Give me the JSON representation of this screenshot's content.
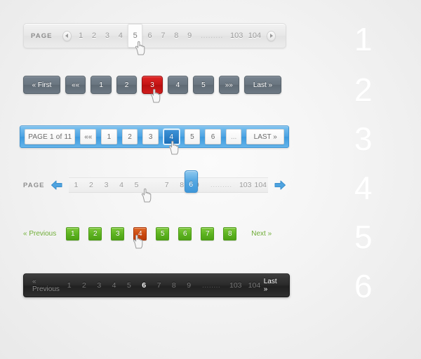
{
  "markers": [
    "1",
    "2",
    "3",
    "4",
    "5",
    "6"
  ],
  "style1": {
    "name": "light-pagination-bar",
    "label": "PAGE",
    "prev_icon": "left-arrow-circle-icon",
    "next_icon": "right-arrow-circle-icon",
    "pages": [
      "1",
      "2",
      "3",
      "4"
    ],
    "active": "5",
    "pages_after": [
      "6",
      "7",
      "8",
      "9"
    ],
    "ellipsis": ".........",
    "tail_pages": [
      "103",
      "104"
    ]
  },
  "style2": {
    "name": "slate-button-pagination",
    "first_label": "« First",
    "prev_label": "««",
    "pages": [
      "1",
      "2"
    ],
    "active": "3",
    "pages_after": [
      "4",
      "5"
    ],
    "next_label": "»»",
    "last_label": "Last »",
    "active_color": "#c31414",
    "button_color": "#69757f"
  },
  "style3": {
    "name": "blue-bar-pagination",
    "page_info": "PAGE 1 of 11",
    "prev_label": "««",
    "pages": [
      "1",
      "2",
      "3"
    ],
    "active": "4",
    "pages_after": [
      "5",
      "6"
    ],
    "ellipsis": "...",
    "last_label": "LAST »",
    "bar_color": "#4ba3e3",
    "active_color": "#1c6fb8"
  },
  "style4": {
    "name": "slider-pagination",
    "label": "PAGE",
    "prev_icon": "left-arrow-icon",
    "next_icon": "right-arrow-icon",
    "pages": [
      "1",
      "2",
      "3",
      "4",
      "5"
    ],
    "active": "6",
    "pages_after": [
      "7",
      "8",
      "9"
    ],
    "ellipsis": ".........",
    "tail_pages": [
      "103",
      "104"
    ],
    "handle_color": "#57a8e2"
  },
  "style5": {
    "name": "green-square-pagination",
    "prev_label": "« Previous",
    "pages": [
      "1",
      "2",
      "3"
    ],
    "active": "4",
    "pages_after": [
      "5",
      "6",
      "7",
      "8"
    ],
    "next_label": "Next »",
    "square_color": "#5bb21f",
    "active_color": "#c9470f",
    "link_color": "#6aa832"
  },
  "style6": {
    "name": "dark-bar-pagination",
    "prev_label": "« Previous",
    "pages": [
      "1",
      "2",
      "3",
      "4",
      "5"
    ],
    "active": "6",
    "pages_after": [
      "7",
      "8",
      "9"
    ],
    "ellipsis": "........",
    "tail_pages": [
      "103",
      "104"
    ],
    "last_label": "Last »",
    "bar_color": "#2c2c2c"
  }
}
